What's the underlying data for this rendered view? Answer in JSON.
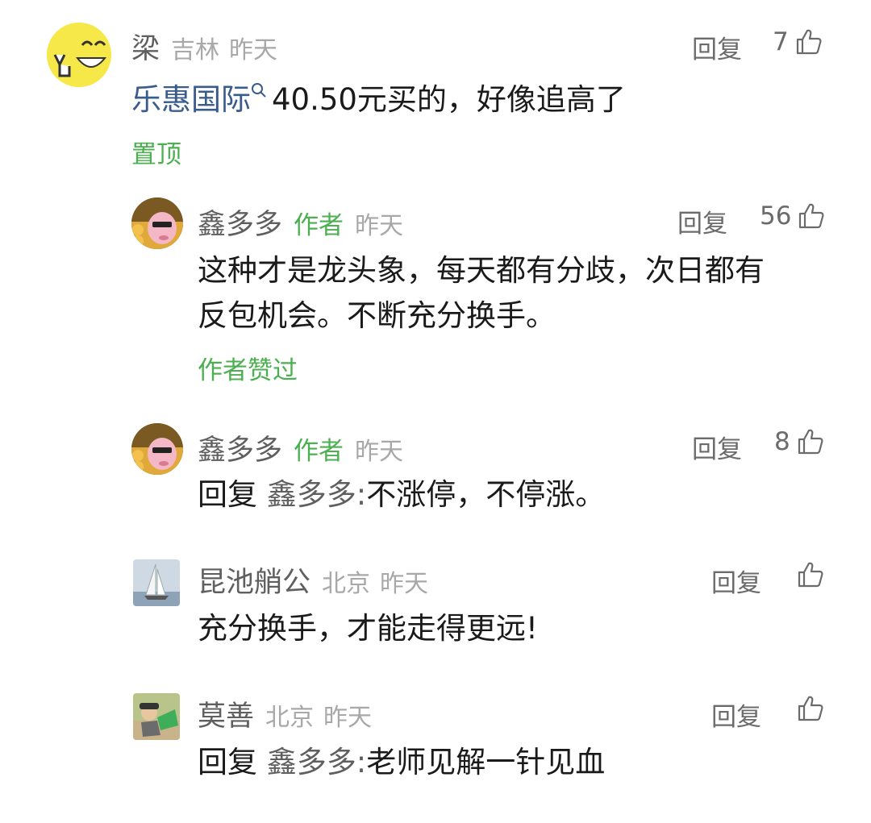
{
  "comments": [
    {
      "name": "梁",
      "location": "吉林",
      "time": "昨天",
      "reply_label": "回复",
      "likes": "7",
      "stock_link": "乐惠国际",
      "text": "40.50元买的，好像追高了",
      "pinned_label": "置顶"
    },
    {
      "name": "鑫多多",
      "author_tag": "作者",
      "time": "昨天",
      "reply_label": "回复",
      "likes": "56",
      "text_line1": "这种才是龙头象，每天都有分歧，次日都有",
      "text_line2": "反包机会。不断充分换手。",
      "liked_label": "作者赞过"
    },
    {
      "name": "鑫多多",
      "author_tag": "作者",
      "time": "昨天",
      "reply_label": "回复",
      "likes": "8",
      "reply_prefix": "回复",
      "reply_target": "鑫多多:",
      "text": "不涨停，不停涨。"
    },
    {
      "name": "昆池艄公",
      "location": "北京",
      "time": "昨天",
      "reply_label": "回复",
      "text": "充分换手，才能走得更远!"
    },
    {
      "name": "莫善",
      "location": "北京",
      "time": "昨天",
      "reply_label": "回复",
      "reply_prefix": "回复",
      "reply_target": "鑫多多:",
      "text": "老师见解一针见血"
    }
  ],
  "colors": {
    "accent_green": "#4caf50",
    "link_blue": "#3a5c8d",
    "muted_gray": "#a8a8a8",
    "name_gray": "#5f5f5f"
  },
  "icons": [
    "smiley-avatar",
    "search-icon",
    "thumbs-up-icon"
  ]
}
